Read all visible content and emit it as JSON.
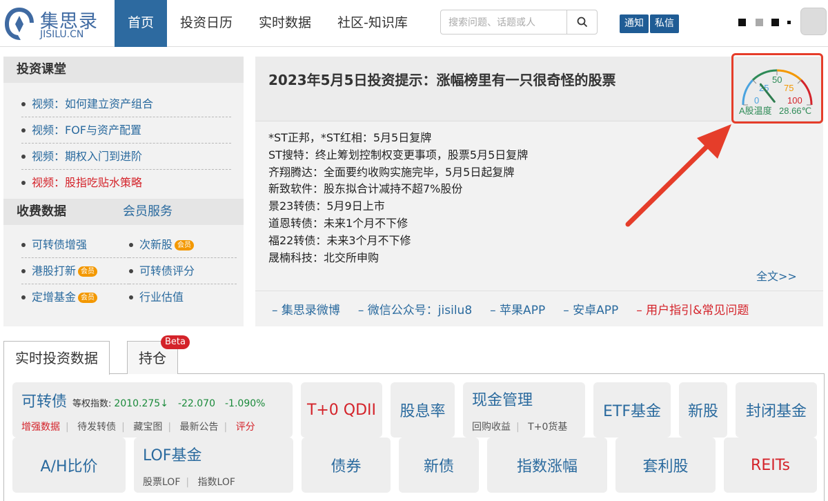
{
  "logo": {
    "cn": "集思录",
    "en": "JISILU.CN"
  },
  "nav": [
    "首页",
    "投资日历",
    "实时数据",
    "社区-知识库"
  ],
  "search": {
    "placeholder": "搜索问题、话题或人"
  },
  "header_buttons": [
    "通知",
    "私信"
  ],
  "left": {
    "lessons_title": "投资课堂",
    "lessons": [
      "视频：如何建立资产组合",
      "视频：FOF与资产配置",
      "视频：期权入门到进阶",
      "视频：股指吃贴水策略"
    ],
    "fee_title": "收费数据",
    "member_title": "会员服务",
    "fee_items": [
      "可转债增强",
      "次新股",
      "港股打新",
      "可转债评分",
      "定增基金",
      "行业估值"
    ],
    "vip_label": "会员"
  },
  "notice": {
    "title": "2023年5月5日投资提示：涨幅榜里有一只很奇怪的股票",
    "lines": [
      "*ST正邦，*ST红相：5月5日复牌",
      "ST搜特：终止筹划控制权变更事项，股票5月5日复牌",
      "齐翔腾达：全面要约收购实施完毕，5月5日起复牌",
      "新致软件：股东拟合计减持不超7%股份",
      "景23转债：5月9日上市",
      "道恩转债：未来1个月不下修",
      "福22转债：未来3个月不下修",
      "晟楠科技：北交所申购"
    ],
    "more": "全文>>",
    "links": [
      "– 集思录微博",
      "– 微信公众号：jisilu8",
      "– 苹果APP",
      "– 安卓APP",
      "– 用户指引&常见问题"
    ]
  },
  "gauge": {
    "ticks": [
      "0",
      "25",
      "50",
      "75",
      "100"
    ],
    "label": "A股温度",
    "value_text": "28.66℃",
    "value": 28.66,
    "colors": [
      "#4aa3df",
      "#2e8b57",
      "#f39800",
      "#d4232a"
    ]
  },
  "tabs": {
    "realtime": "实时投资数据",
    "holdings": "持仓",
    "beta": "Beta"
  },
  "cards": {
    "cb": {
      "title": "可转债",
      "index_label": "等权指数:",
      "index_value": "2010.275",
      "arrow": "↓",
      "change": "-22.070",
      "pct": "-1.090%",
      "subs": [
        "增强数据",
        "待发转债",
        "藏宝图",
        "最新公告",
        "评分"
      ]
    },
    "t0qdii": "T+0 QDII",
    "dividend": "股息率",
    "cash": {
      "title": "现金管理",
      "subs": [
        "回购收益",
        "T+0货基"
      ]
    },
    "etf": "ETF基金",
    "ipo": "新股",
    "closed": "封闭基金",
    "ah": "A/H比价",
    "lof": {
      "title": "LOF基金",
      "subs": [
        "股票LOF",
        "指数LOF"
      ]
    },
    "bond": "债券",
    "newbond": "新债",
    "indexrise": "指数涨幅",
    "arb": "套利股",
    "reits": "REITs"
  }
}
